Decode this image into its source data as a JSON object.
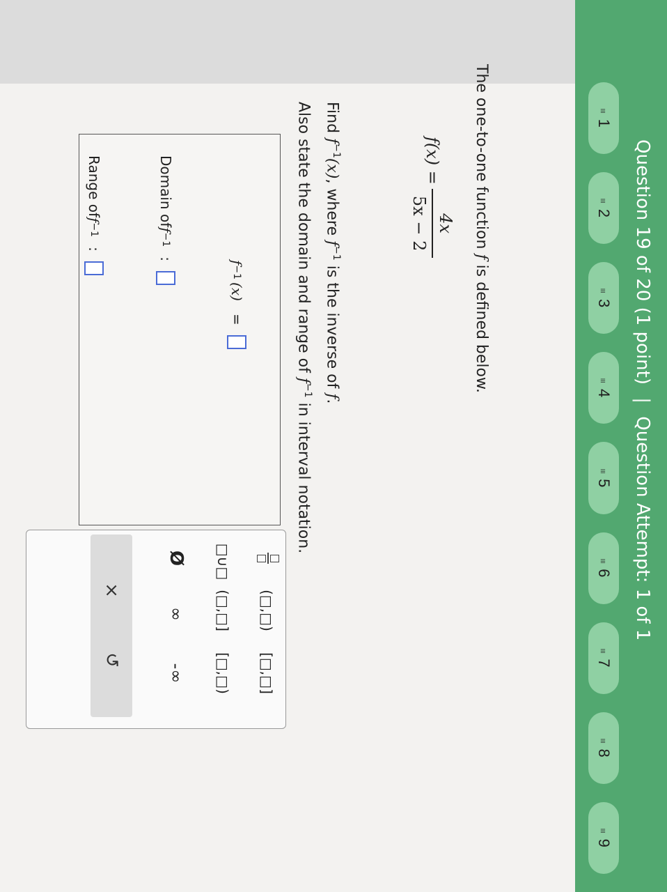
{
  "header": {
    "question_label": "Question 19 of 20 (1 point)",
    "separator": "|",
    "attempt_label": "Question Attempt: 1 of 1"
  },
  "nav": {
    "items": [
      {
        "label": "1"
      },
      {
        "label": "2"
      },
      {
        "label": "3"
      },
      {
        "label": "4"
      },
      {
        "label": "5"
      },
      {
        "label": "6"
      },
      {
        "label": "7"
      },
      {
        "label": "8"
      },
      {
        "label": "9"
      }
    ],
    "glyph": "≡"
  },
  "problem": {
    "intro_prefix": "The one-to-one function ",
    "intro_f": "f",
    "intro_suffix": " is defined below.",
    "fx_lhs": "f(x) =",
    "fx_num": "4x",
    "fx_den": "5x − 2",
    "find_prefix": "Find ",
    "find_fn": "f",
    "find_sup": "−1",
    "find_arg": "(x)",
    "find_mid": ", where ",
    "find_fn2": "f",
    "find_sup2": "−1",
    "find_suffix": " is the inverse of ",
    "find_f": "f",
    "find_end": ".",
    "also_prefix": "Also state the domain and range of ",
    "also_fn": "f",
    "also_sup": "−1",
    "also_suffix": " in interval notation."
  },
  "answer": {
    "inverse_fn": "f",
    "inverse_sup": "−1",
    "inverse_arg": "(x)",
    "inverse_eq": "=",
    "domain_label": "Domain of ",
    "domain_fn": "f",
    "domain_sup": "−1",
    "domain_colon": ":",
    "range_label": "Range of ",
    "range_fn": "f",
    "range_sup": "−1",
    "range_colon": ":"
  },
  "keypad": {
    "open_open": "(□,□)",
    "closed_closed": "[□,□]",
    "union": "□∪□",
    "closed_open": "(□,□]",
    "open_closed": "[□,□)",
    "empty_set": "Ø",
    "infinity": "∞",
    "neg_infinity": "-∞",
    "clear": "×",
    "undo": "↺"
  }
}
